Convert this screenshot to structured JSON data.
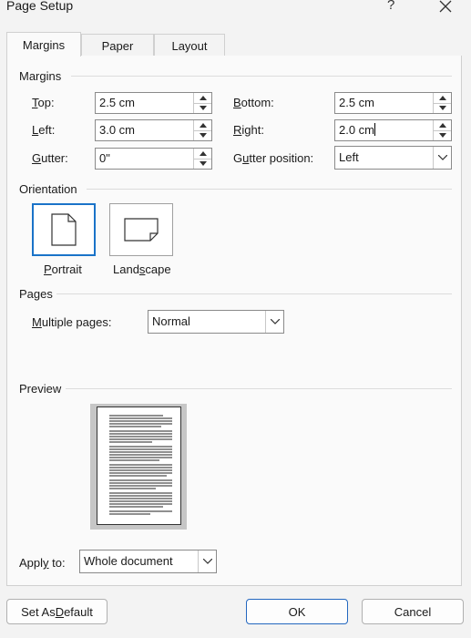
{
  "window": {
    "title": "Page Setup",
    "help": "?"
  },
  "tabs": [
    {
      "label": "Margins",
      "active": true
    },
    {
      "label": "Paper",
      "active": false
    },
    {
      "label": "Layout",
      "active": false
    }
  ],
  "margins": {
    "section": "Margins",
    "top": {
      "label_u": "T",
      "label_rest": "op:",
      "value": "2.5 cm"
    },
    "bottom": {
      "label_u": "B",
      "label_rest": "ottom:",
      "value": "2.5 cm"
    },
    "left": {
      "label_u": "L",
      "label_rest": "eft:",
      "value": "3.0 cm"
    },
    "right": {
      "label_u": "R",
      "label_rest": "ight:",
      "value": "2.0 cm"
    },
    "gutter": {
      "label_u": "G",
      "label_rest": "utter:",
      "value": "0\""
    },
    "gutter_position": {
      "label_pre": "G",
      "label_u": "u",
      "label_rest": "tter position:",
      "value": "Left"
    }
  },
  "orientation": {
    "section": "Orientation",
    "portrait": {
      "label_u": "P",
      "label_rest": "ortrait",
      "selected": true
    },
    "landscape": {
      "label_pre": "Land",
      "label_u": "s",
      "label_rest": "cape",
      "selected": false
    }
  },
  "pages": {
    "section": "Pages",
    "multiple_pages": {
      "label_u": "M",
      "label_rest": "ultiple pages:",
      "value": "Normal"
    }
  },
  "preview": {
    "section": "Preview"
  },
  "apply_to": {
    "label_pre": "Appl",
    "label_u": "y",
    "label_rest": " to:",
    "value": "Whole document"
  },
  "buttons": {
    "default": {
      "label_pre": "Set As ",
      "label_u": "D",
      "label_rest": "efault"
    },
    "ok": "OK",
    "cancel": "Cancel"
  },
  "colors": {
    "accent": "#1a73c8",
    "panel": "#fafafa",
    "background": "#f3f3f3"
  },
  "icons": [
    "help-icon",
    "close-icon",
    "spin-up-icon",
    "spin-down-icon",
    "chevron-down-icon",
    "portrait-page-icon",
    "landscape-page-icon"
  ]
}
